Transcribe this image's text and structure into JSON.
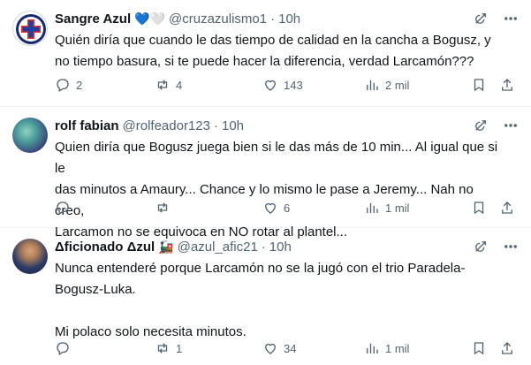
{
  "tweets": [
    {
      "name": "Sangre Azul",
      "name_emoji": "💙🤍",
      "handle": "@cruzazulismo1",
      "dot": "·",
      "time": "10h",
      "text": "Quién diría que cuando le das tiempo de calidad en la cancha a Bogusz, y\nno tiempo basura, si te puede hacer la diferencia, verdad Larcamón???",
      "replies": "2",
      "reposts": "4",
      "likes": "143",
      "views": "2 mil"
    },
    {
      "name": "rolf fabian",
      "name_emoji": "",
      "handle": "@rolfeador123",
      "dot": "·",
      "time": "10h",
      "text": "Quien diría que Bogusz juega bien si le das más de 10 min... Al igual que si le\ndas minutos a Amaury... Chance y lo mismo le pase a Jeremy... Nah no creo,\nLarcamon no se equivoca en NO rotar al plantel...",
      "replies": "",
      "reposts": "",
      "likes": "6",
      "views": "1 mil"
    },
    {
      "name": "Δficionado Δzul",
      "name_emoji": "🚂",
      "handle": "@azul_afic21",
      "dot": "·",
      "time": "10h",
      "text": "Nunca entenderé porque Larcamón no se la jugó con el trio Paradela-\nBogusz-Luka.\n\nMi polaco solo necesita minutos.",
      "replies": "",
      "reposts": "1",
      "likes": "34",
      "views": "1 mil"
    }
  ]
}
